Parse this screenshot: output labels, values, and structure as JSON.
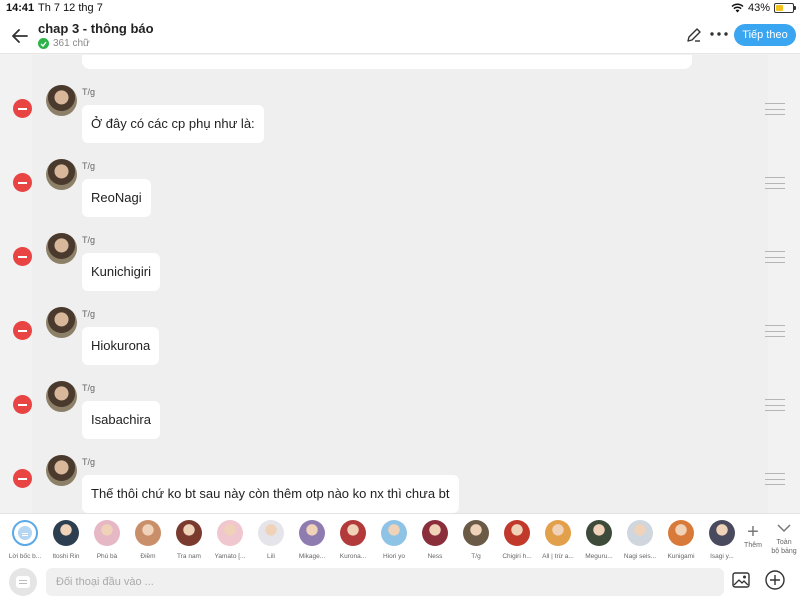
{
  "status_bar": {
    "time": "14:41",
    "date": "Th 7 12 thg 7",
    "battery": "43%"
  },
  "header": {
    "title": "chap 3 - thông báo",
    "word_count": "361 chữ",
    "next_label": "Tiếp theo"
  },
  "messages": [
    {
      "author": "T/g",
      "text": "Ở đây có các cp phụ như là:"
    },
    {
      "author": "T/g",
      "text": "ReoNagi"
    },
    {
      "author": "T/g",
      "text": "Kunichigiri"
    },
    {
      "author": "T/g",
      "text": "Hiokurona"
    },
    {
      "author": "T/g",
      "text": "Isabachira"
    },
    {
      "author": "T/g",
      "text": "Thế thôi chứ ko bt sau này còn thêm otp nào ko nx thì chưa bt"
    }
  ],
  "characters": [
    {
      "name": "Lời bốc b...",
      "color": "#b4d6f2"
    },
    {
      "name": "Itoshi Rin",
      "color": "#2c3e50"
    },
    {
      "name": "Phú bà",
      "color": "#e6b7c4"
    },
    {
      "name": "Điềm",
      "color": "#c98f6a"
    },
    {
      "name": "Tra nam",
      "color": "#7a3b2e"
    },
    {
      "name": "Yamato [...",
      "color": "#f0c6cf"
    },
    {
      "name": "Lili",
      "color": "#e4e4ea"
    },
    {
      "name": "Mikage...",
      "color": "#8e7bb0"
    },
    {
      "name": "Kurona...",
      "color": "#b23a3a"
    },
    {
      "name": "Hiori yo",
      "color": "#8fc3e6"
    },
    {
      "name": "Ness",
      "color": "#8a2e3b"
    },
    {
      "name": "T/g",
      "color": "#6b5a45"
    },
    {
      "name": "Chigiri h...",
      "color": "#c0392b"
    },
    {
      "name": "All | trừ a...",
      "color": "#e2a04a"
    },
    {
      "name": "Meguru...",
      "color": "#3e4a3a"
    },
    {
      "name": "Nagi seis...",
      "color": "#cfd6dd"
    },
    {
      "name": "Kunigami",
      "color": "#d87a3a"
    },
    {
      "name": "Isagi y...",
      "color": "#4a4a5e"
    }
  ],
  "add_character_label": "Thêm",
  "all_characters_label": [
    "Toàn",
    "bộ bảng"
  ],
  "input": {
    "placeholder": "Đối thoại đầu vào ..."
  }
}
